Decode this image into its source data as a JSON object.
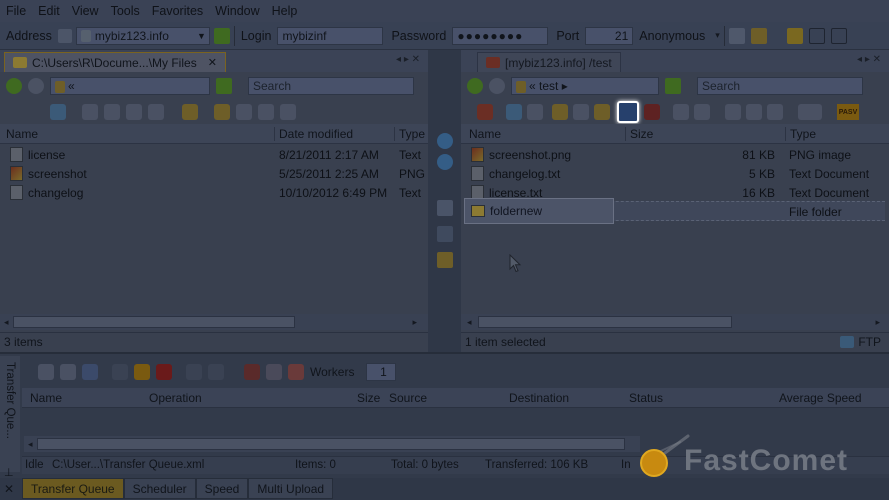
{
  "menu": [
    "File",
    "Edit",
    "View",
    "Tools",
    "Favorites",
    "Window",
    "Help"
  ],
  "connection": {
    "address_label": "Address",
    "address_value": "mybiz123.info",
    "login_label": "Login",
    "login_value": "mybizinf",
    "password_label": "Password",
    "password_value": "●●●●●●●●",
    "port_label": "Port",
    "port_value": "21",
    "anonymous_label": "Anonymous"
  },
  "left_pane": {
    "tab_title": "C:\\Users\\R\\Docume...\\My Files",
    "path": "«",
    "search_placeholder": "Search",
    "columns": [
      "Name",
      "Date modified",
      "Type"
    ],
    "files": [
      {
        "name": "license",
        "date": "8/21/2011 2:17 AM",
        "type": "Text",
        "icon": "text-file-icon"
      },
      {
        "name": "screenshot",
        "date": "5/25/2011 2:25 AM",
        "type": "PNG",
        "icon": "image-file-icon"
      },
      {
        "name": "changelog",
        "date": "10/10/2012 6:49 PM",
        "type": "Text",
        "icon": "text-file-icon"
      }
    ],
    "status": "3 items"
  },
  "right_pane": {
    "tab_title": "[mybiz123.info] /test",
    "path": "test",
    "search_placeholder": "Search",
    "columns": [
      "Name",
      "Size",
      "Type"
    ],
    "files": [
      {
        "name": "screenshot.png",
        "size": "81 KB",
        "type": "PNG image",
        "icon": "image-file-icon"
      },
      {
        "name": "changelog.txt",
        "size": "5 KB",
        "type": "Text Document",
        "icon": "text-file-icon"
      },
      {
        "name": "license.txt",
        "size": "16 KB",
        "type": "Text Document",
        "icon": "text-file-icon"
      }
    ],
    "new_folder": {
      "name": "foldernew",
      "type": "File folder"
    },
    "status": "1 item selected",
    "protocol": "FTP",
    "pasv_label": "PASV"
  },
  "queue": {
    "side_label": "Transfer Que...",
    "workers_label": "Workers",
    "workers_value": "1",
    "columns": [
      "Name",
      "Operation",
      "Size",
      "Source",
      "Destination",
      "Status",
      "Average Speed"
    ],
    "status_idle": "Idle",
    "status_path": "C:\\User...\\Transfer Queue.xml",
    "status_items": "Items: 0",
    "status_total": "Total: 0 bytes",
    "status_transferred": "Transferred: 106 KB",
    "status_in": "In"
  },
  "bottom_tabs": [
    "Transfer Queue",
    "Scheduler",
    "Speed",
    "Multi Upload"
  ],
  "watermark": "FastComet",
  "colors": {
    "accent": "#c8a030",
    "background": "#2f3747",
    "highlight": "#ffffff"
  }
}
